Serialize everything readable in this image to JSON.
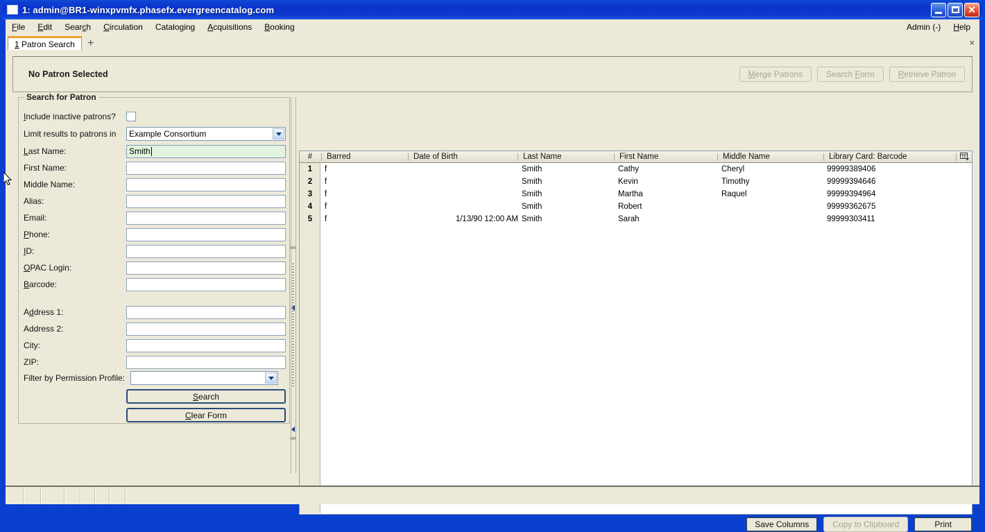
{
  "window": {
    "title": "1: admin@BR1-winxpvmfx.phasefx.evergreencatalog.com",
    "minimize_label": "minimize",
    "maximize_label": "maximize",
    "close_label": "✕"
  },
  "menubar": {
    "items": [
      {
        "label": "File",
        "accel": "F"
      },
      {
        "label": "Edit",
        "accel": "E"
      },
      {
        "label": "Search",
        "accel": "c"
      },
      {
        "label": "Circulation",
        "accel": "C"
      },
      {
        "label": "Cataloging",
        "accel": "g"
      },
      {
        "label": "Acquisitions",
        "accel": "A"
      },
      {
        "label": "Booking",
        "accel": "B"
      }
    ],
    "right_items": [
      {
        "label": "Admin (-)"
      },
      {
        "label": "Help",
        "accel": "H"
      }
    ]
  },
  "tabbar": {
    "tabs": [
      {
        "number": "1",
        "label": "Patron Search"
      }
    ],
    "new_tab_label": "+",
    "close_label": "×"
  },
  "patron_header": {
    "status_text": "No Patron Selected",
    "buttons": [
      {
        "label": "Merge Patrons",
        "enabled": false
      },
      {
        "label": "Search Form",
        "enabled": false
      },
      {
        "label": "Retrieve Patron",
        "enabled": false
      }
    ]
  },
  "search_form": {
    "legend": "Search for Patron",
    "include_inactive_label": "Include inactive patrons?",
    "include_inactive_checked": false,
    "limit_results_label": "Limit results to patrons in",
    "limit_results_value": "Example Consortium",
    "fields": [
      {
        "label": "Last Name:",
        "value": "Smith",
        "focused": true
      },
      {
        "label": "First Name:",
        "value": "",
        "focused": false
      },
      {
        "label": "Middle Name:",
        "value": "",
        "focused": false
      },
      {
        "label": "Alias:",
        "value": "",
        "focused": false
      },
      {
        "label": "Email:",
        "value": "",
        "focused": false
      },
      {
        "label": "Phone:",
        "value": "",
        "focused": false
      },
      {
        "label": "ID:",
        "value": "",
        "focused": false
      },
      {
        "label": "OPAC Login:",
        "value": "",
        "focused": false
      },
      {
        "label": "Barcode:",
        "value": "",
        "focused": false
      }
    ],
    "address_fields": [
      {
        "label": "Address 1:",
        "value": ""
      },
      {
        "label": "Address 2:",
        "value": ""
      },
      {
        "label": "City:",
        "value": ""
      },
      {
        "label": "ZIP:",
        "value": ""
      }
    ],
    "permission_profile_label": "Filter by Permission Profile:",
    "permission_profile_value": "",
    "search_button": "Search",
    "clear_button": "Clear Form"
  },
  "results_table": {
    "columns": [
      {
        "key": "num",
        "label": "#"
      },
      {
        "key": "barred",
        "label": "Barred"
      },
      {
        "key": "dob",
        "label": "Date of Birth"
      },
      {
        "key": "last",
        "label": "Last Name"
      },
      {
        "key": "first",
        "label": "First Name"
      },
      {
        "key": "middle",
        "label": "Middle Name"
      },
      {
        "key": "barcode",
        "label": "Library Card: Barcode"
      }
    ],
    "rows": [
      {
        "num": "1",
        "barred": "f",
        "dob": "",
        "last": "Smith",
        "first": "Cathy",
        "middle": "Cheryl",
        "barcode": "99999389406"
      },
      {
        "num": "2",
        "barred": "f",
        "dob": "",
        "last": "Smith",
        "first": "Kevin",
        "middle": "Timothy",
        "barcode": "99999394646"
      },
      {
        "num": "3",
        "barred": "f",
        "dob": "",
        "last": "Smith",
        "first": "Martha",
        "middle": "Raquel",
        "barcode": "99999394964"
      },
      {
        "num": "4",
        "barred": "f",
        "dob": "",
        "last": "Smith",
        "first": "Robert",
        "middle": "",
        "barcode": "99999362675"
      },
      {
        "num": "5",
        "barred": "f",
        "dob": "1/13/90 12:00 AM",
        "last": "Smith",
        "first": "Sarah",
        "middle": "",
        "barcode": "99999303411"
      }
    ],
    "column_picker_icon": "column-picker-icon"
  },
  "table_buttons": [
    {
      "label": "Save Columns",
      "enabled": true
    },
    {
      "label": "Copy to Clipboard",
      "enabled": false
    },
    {
      "label": "Print",
      "enabled": true
    }
  ],
  "statusbar": {
    "segments": [
      "",
      "",
      "",
      "",
      "",
      "",
      ""
    ]
  },
  "colors": {
    "titlebar_blue": "#0a33cb",
    "face": "#ece9d8",
    "focused_field": "#e2f4e0",
    "tab_accent": "#f0a030"
  }
}
